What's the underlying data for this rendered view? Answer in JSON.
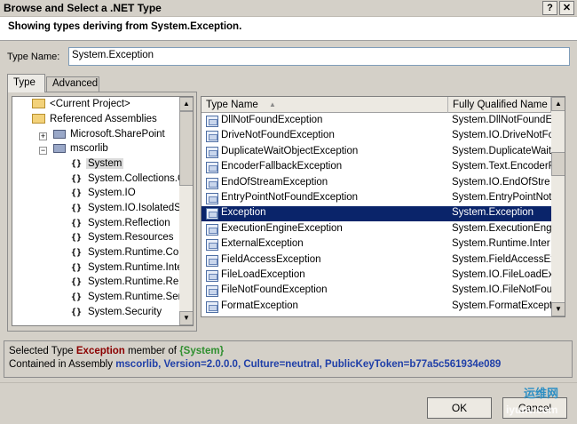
{
  "window": {
    "title": "Browse and Select a .NET Type",
    "subtitle": "Showing types deriving from System.Exception.",
    "help_label": "?",
    "close_label": "✕"
  },
  "type_name": {
    "label": "Type Name:",
    "value": "System.Exception"
  },
  "tabs": [
    {
      "label": "Type",
      "active": true
    },
    {
      "label": "Advanced",
      "active": false
    }
  ],
  "tree": {
    "items": [
      {
        "label": "<Current Project>",
        "kind": "folder"
      },
      {
        "label": "Referenced Assemblies",
        "kind": "folder"
      },
      {
        "label": "Microsoft.SharePoint",
        "kind": "assembly"
      },
      {
        "label": "mscorlib",
        "kind": "assembly"
      },
      {
        "label": "System",
        "kind": "namespace",
        "selected": true
      },
      {
        "label": "System.Collections.G",
        "kind": "namespace"
      },
      {
        "label": "System.IO",
        "kind": "namespace"
      },
      {
        "label": "System.IO.IsolatedS",
        "kind": "namespace"
      },
      {
        "label": "System.Reflection",
        "kind": "namespace"
      },
      {
        "label": "System.Resources",
        "kind": "namespace"
      },
      {
        "label": "System.Runtime.Com",
        "kind": "namespace"
      },
      {
        "label": "System.Runtime.Inte",
        "kind": "namespace"
      },
      {
        "label": "System.Runtime.Rem",
        "kind": "namespace"
      },
      {
        "label": "System.Runtime.Seri",
        "kind": "namespace"
      },
      {
        "label": "System.Security",
        "kind": "namespace"
      }
    ],
    "ns_glyph": "{}",
    "expand_plus": "+",
    "expand_minus": "−"
  },
  "list": {
    "columns": {
      "name": "Type Name",
      "fqn": "Fully Qualified Name"
    },
    "sort_glyph": "▲",
    "rows": [
      {
        "name": "DllNotFoundException",
        "fqn": "System.DllNotFoundEx"
      },
      {
        "name": "DriveNotFoundException",
        "fqn": "System.IO.DriveNotFo"
      },
      {
        "name": "DuplicateWaitObjectException",
        "fqn": "System.DuplicateWaitO"
      },
      {
        "name": "EncoderFallbackException",
        "fqn": "System.Text.EncoderF"
      },
      {
        "name": "EndOfStreamException",
        "fqn": "System.IO.EndOfStre"
      },
      {
        "name": "EntryPointNotFoundException",
        "fqn": "System.EntryPointNot"
      },
      {
        "name": "Exception",
        "fqn": "System.Exception",
        "selected": true
      },
      {
        "name": "ExecutionEngineException",
        "fqn": "System.ExecutionEngi"
      },
      {
        "name": "ExternalException",
        "fqn": "System.Runtime.Inter"
      },
      {
        "name": "FieldAccessException",
        "fqn": "System.FieldAccessEx"
      },
      {
        "name": "FileLoadException",
        "fqn": "System.IO.FileLoadEx"
      },
      {
        "name": "FileNotFoundException",
        "fqn": "System.IO.FileNotFou"
      },
      {
        "name": "FormatException",
        "fqn": "System.FormatExcept"
      }
    ]
  },
  "status": {
    "line1_prefix": "Selected Type ",
    "line1_type": "Exception",
    "line1_mid": " member of ",
    "line1_ns": "{System}",
    "line2_prefix": "Contained in Assembly ",
    "line2_assembly": "mscorlib, Version=2.0.0.0, Culture=neutral, PublicKeyToken=b77a5c561934e089"
  },
  "buttons": {
    "ok": "OK",
    "cancel": "Cancel"
  },
  "scroll": {
    "up": "▲",
    "down": "▼"
  },
  "watermark": {
    "line1": "运维网",
    "line2": "iyunv.com"
  }
}
